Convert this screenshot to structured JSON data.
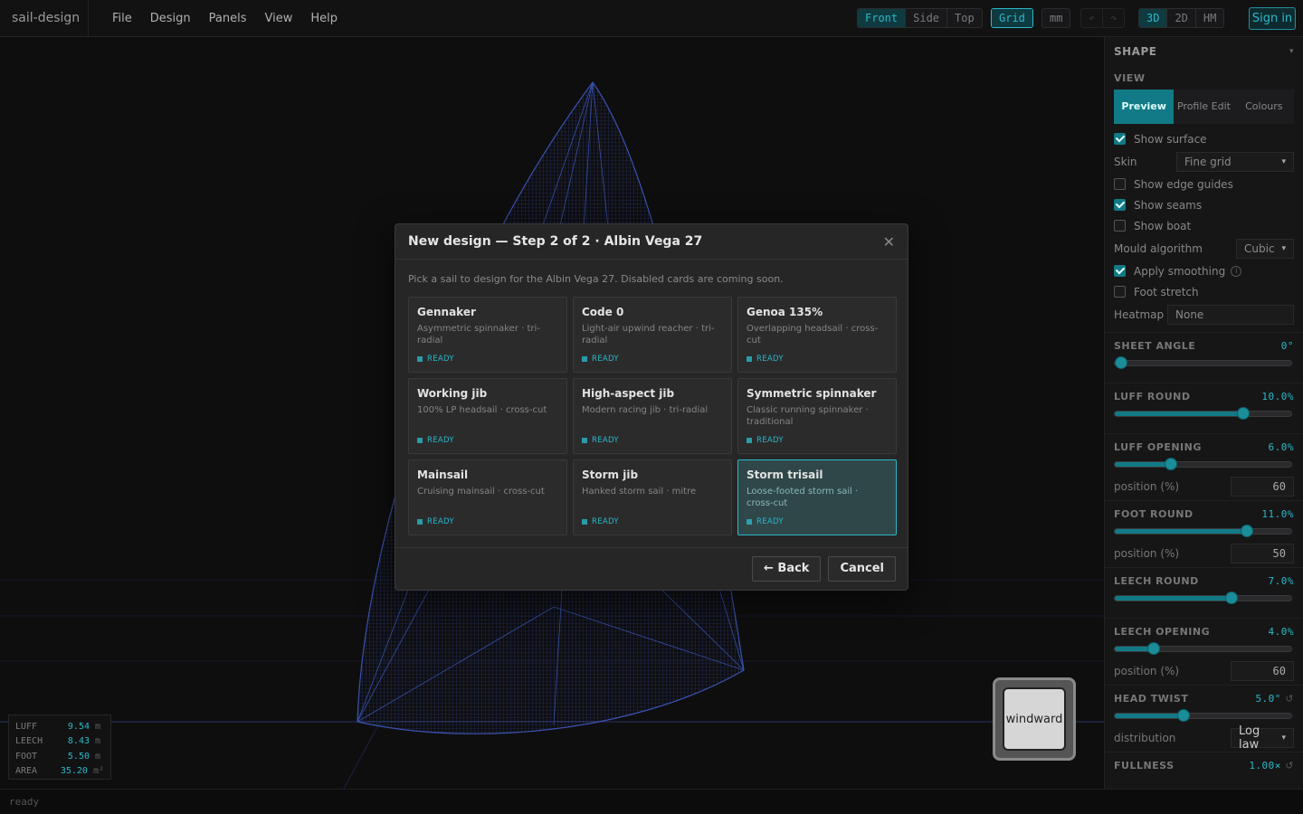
{
  "app": {
    "brand": "sail-design"
  },
  "menus": [
    "File",
    "Design",
    "Panels",
    "View",
    "Help"
  ],
  "toolbar": {
    "views": [
      "Front",
      "Side",
      "Top"
    ],
    "grid": "Grid",
    "units": "mm",
    "undo": "↶",
    "redo": "↷",
    "modes": [
      "3D",
      "2D",
      "HM"
    ],
    "signin": "Sign in"
  },
  "stats": [
    {
      "k": "LUFF",
      "v": "9.54",
      "u": "m"
    },
    {
      "k": "LEECH",
      "v": "8.43",
      "u": "m"
    },
    {
      "k": "FOOT",
      "v": "5.50",
      "u": "m"
    },
    {
      "k": "AREA",
      "v": "35.20",
      "u": "m²"
    }
  ],
  "compass": {
    "label": "windward"
  },
  "status": "ready",
  "panel": {
    "title": "SHAPE",
    "caret": "▾",
    "view_label": "VIEW",
    "view_tabs": [
      "Preview",
      "Profile Edit",
      "Colours"
    ],
    "show_surface": "Show surface",
    "skin_label": "Skin",
    "skin_value": "Fine grid",
    "show_edge_guides": "Show edge guides",
    "show_seams": "Show seams",
    "show_boat": "Show boat",
    "mould_label": "Mould algorithm",
    "mould_value": "Cubic",
    "apply_smoothing": "Apply smoothing",
    "info": "i",
    "foot_stretch": "Foot stretch",
    "heatmap_label": "Heatmap",
    "heatmap_value": "None",
    "position_label": "position (%)",
    "distribution_label": "distribution",
    "distribution_value": "Log law",
    "reset": "↺",
    "sliders": [
      {
        "label": "SHEET ANGLE",
        "value": "0°",
        "frac": 0.0
      },
      {
        "label": "LUFF ROUND",
        "value": "10.0%",
        "frac": 0.73,
        "pos": ""
      },
      {
        "label": "LUFF OPENING",
        "value": "6.0%",
        "frac": 0.32,
        "pos": "60"
      },
      {
        "label": "FOOT ROUND",
        "value": "11.0%",
        "frac": 0.75,
        "pos": "50"
      },
      {
        "label": "LEECH ROUND",
        "value": "7.0%",
        "frac": 0.66,
        "pos": ""
      },
      {
        "label": "LEECH OPENING",
        "value": "4.0%",
        "frac": 0.22,
        "pos": "60"
      },
      {
        "label": "HEAD TWIST",
        "value": "5.0°",
        "frac": 0.39
      },
      {
        "label": "FULLNESS",
        "value": "1.00×"
      }
    ]
  },
  "modal": {
    "title": "New design — Step 2 of 2 · Albin Vega 27",
    "close": "✕",
    "description": "Pick a sail to design for the Albin Vega 27. Disabled cards are coming soon.",
    "cards": [
      {
        "name": "Gennaker",
        "sub": "Asymmetric spinnaker · tri-radial",
        "status": "READY"
      },
      {
        "name": "Code 0",
        "sub": "Light-air upwind reacher · tri-radial",
        "status": "READY"
      },
      {
        "name": "Genoa 135%",
        "sub": "Overlapping headsail · cross-cut",
        "status": "READY"
      },
      {
        "name": "Working jib",
        "sub": "100% LP headsail · cross-cut",
        "status": "READY"
      },
      {
        "name": "High-aspect jib",
        "sub": "Modern racing jib · tri-radial",
        "status": "READY"
      },
      {
        "name": "Symmetric spinnaker",
        "sub": "Classic running spinnaker · traditional",
        "status": "READY"
      },
      {
        "name": "Mainsail",
        "sub": "Cruising mainsail · cross-cut",
        "status": "READY"
      },
      {
        "name": "Storm jib",
        "sub": "Hanked storm sail · mitre",
        "status": "READY"
      },
      {
        "name": "Storm trisail",
        "sub": "Loose-footed storm sail · cross-cut",
        "status": "READY"
      }
    ],
    "back": "← Back",
    "cancel": "Cancel"
  }
}
